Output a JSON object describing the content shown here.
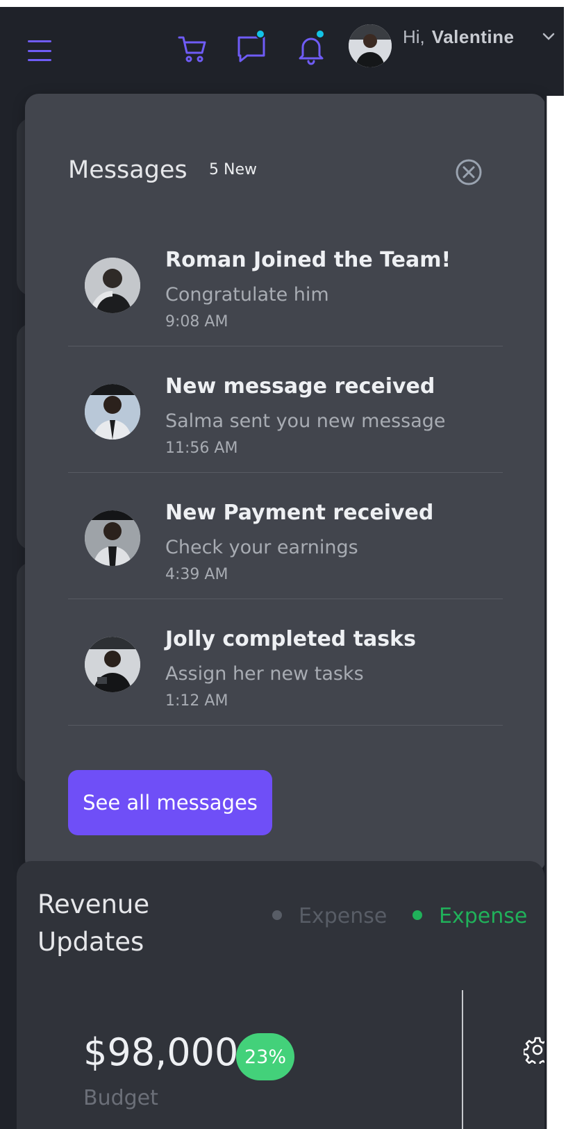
{
  "header": {
    "greeting": "Hi,",
    "user_name": "Valentine",
    "icons": [
      "menu-icon",
      "cart-icon",
      "chat-icon",
      "bell-icon",
      "chevron-down-icon"
    ]
  },
  "messages_panel": {
    "title": "Messages",
    "new_count": "5 New",
    "items": [
      {
        "title": "Roman Joined the Team!",
        "subtitle": "Congratulate him",
        "time": "9:08 AM"
      },
      {
        "title": "New message received",
        "subtitle": "Salma sent you new message",
        "time": "11:56 AM"
      },
      {
        "title": "New Payment received",
        "subtitle": "Check your earnings",
        "time": "4:39 AM"
      },
      {
        "title": "Jolly completed tasks",
        "subtitle": "Assign her new tasks",
        "time": "1:12 AM"
      }
    ],
    "see_all_label": "See all messages"
  },
  "revenue": {
    "title": "Revenue Updates",
    "legend": [
      {
        "label": "Expense",
        "color": "#585d66"
      },
      {
        "label": "Expense",
        "color": "#20b15a"
      }
    ],
    "amount": "$98,000",
    "change": "23%",
    "amount_label": "Budget"
  },
  "colors": {
    "accent": "#6f4ff7",
    "notification_dot": "#13c3e6",
    "success": "#43d17a",
    "panel_bg": "#42454d",
    "app_bg": "#1f2229"
  }
}
